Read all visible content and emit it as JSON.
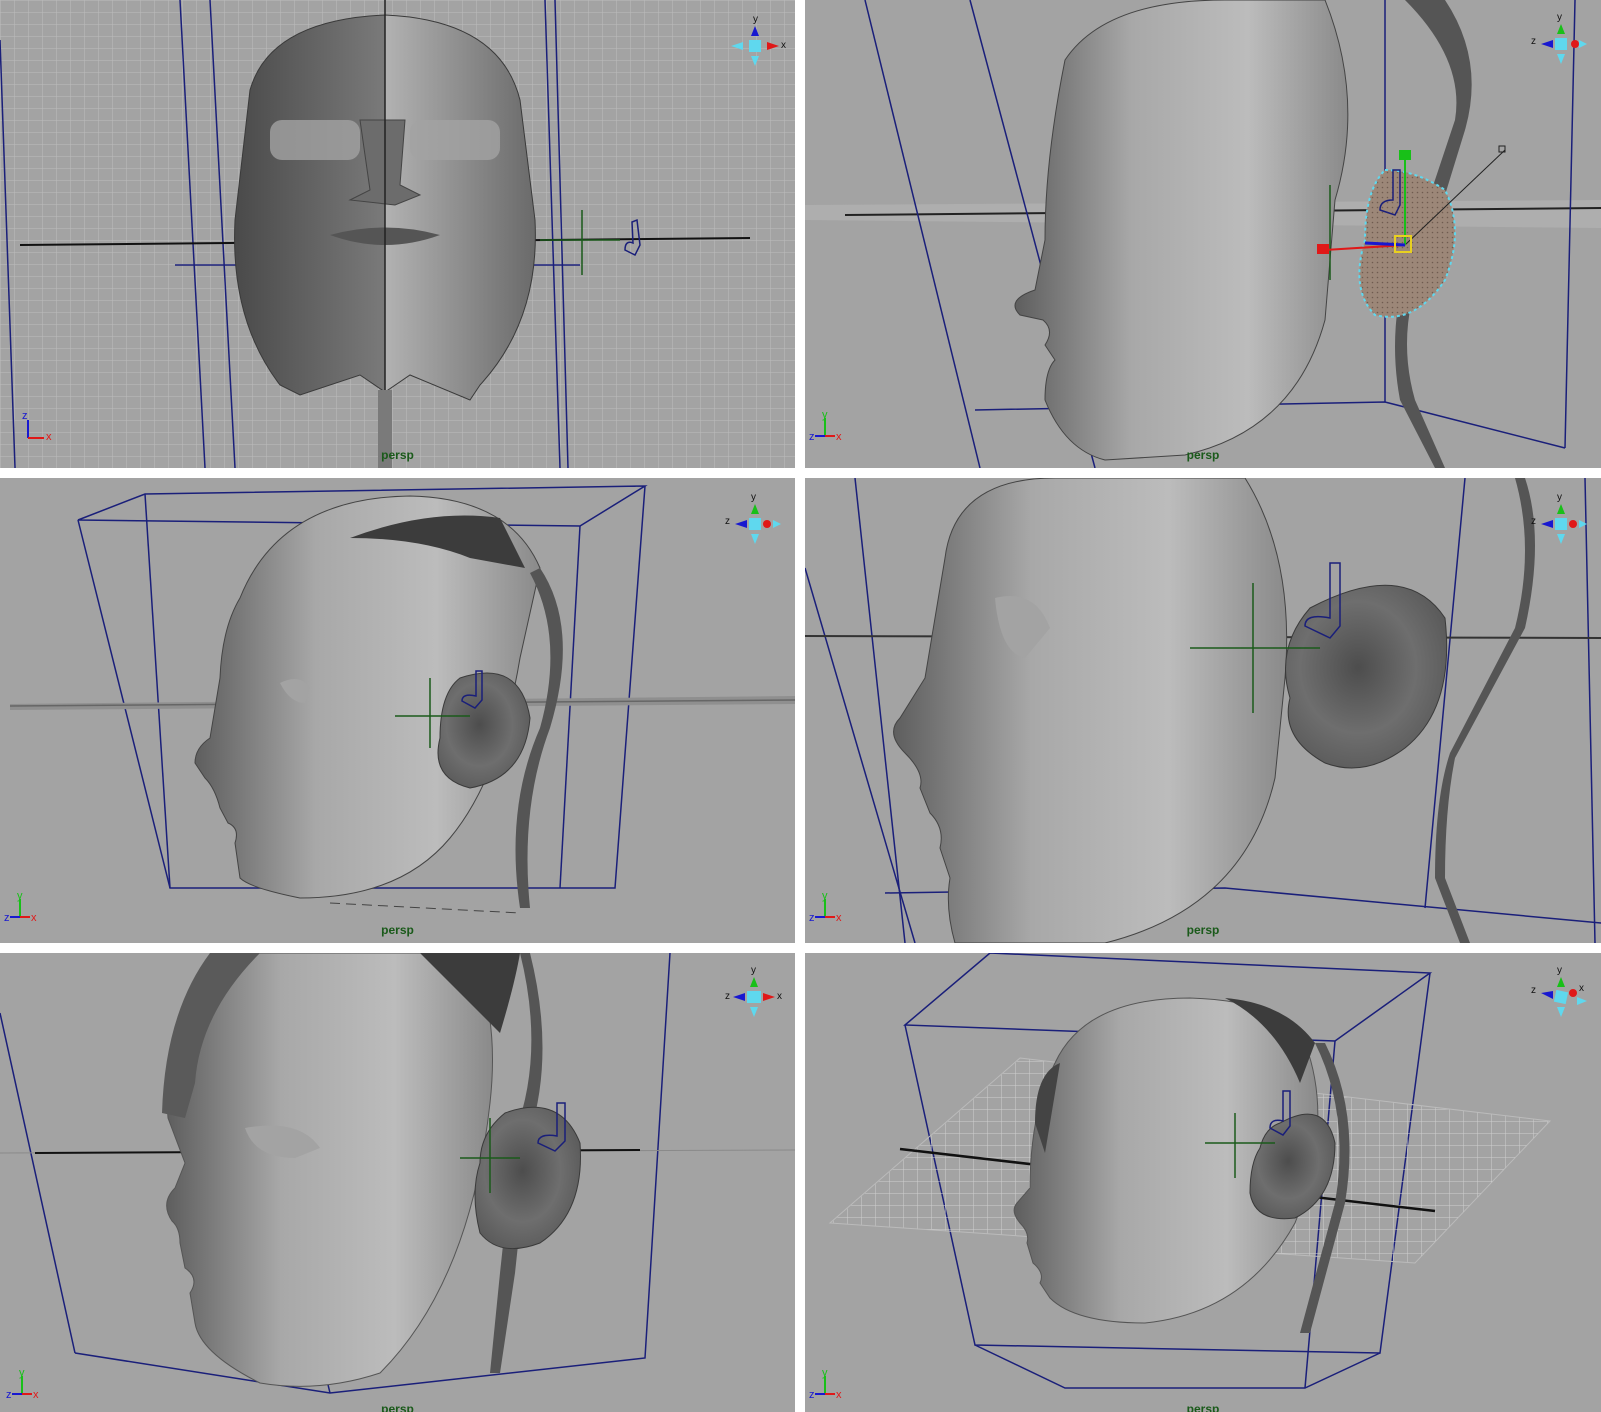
{
  "viewports": [
    {
      "id": "vp1",
      "camera_label": "persp",
      "axis_labels": {
        "up": "z",
        "right": "x"
      },
      "cube_labels": [
        "y",
        "x"
      ]
    },
    {
      "id": "vp2",
      "camera_label": "persp",
      "axis_labels": {
        "up": "y",
        "left": "z",
        "right": "x"
      },
      "cube_labels": [
        "y",
        "z"
      ]
    },
    {
      "id": "vp3",
      "camera_label": "persp",
      "axis_labels": {
        "up": "y",
        "left": "z",
        "right": "x"
      },
      "cube_labels": [
        "y",
        "z"
      ]
    },
    {
      "id": "vp4",
      "camera_label": "persp",
      "axis_labels": {
        "up": "y",
        "left": "z",
        "right": "x"
      },
      "cube_labels": [
        "y",
        "z"
      ]
    },
    {
      "id": "vp5",
      "camera_label": "persp",
      "axis_labels": {
        "up": "y",
        "left": "z",
        "right": "x"
      },
      "cube_labels": [
        "y",
        "z",
        "x"
      ]
    },
    {
      "id": "vp6",
      "camera_label": "persp",
      "axis_labels": {
        "up": "y",
        "left": "z",
        "right": "x"
      },
      "cube_labels": [
        "y",
        "z",
        "x"
      ]
    }
  ],
  "colors": {
    "viewport_bg": "#a3a3a3",
    "bbox": "#1a1f7a",
    "grid": "#d2d2d2",
    "camera_label": "#1a5a1a",
    "axis_x": "#e01818",
    "axis_y": "#18c018",
    "axis_z": "#1818d0",
    "cube": "#5fd8ee"
  },
  "icons": [
    "view-cube-icon",
    "axis-triad-icon",
    "locator-icon",
    "move-manipulator-icon",
    "ear-icon"
  ]
}
